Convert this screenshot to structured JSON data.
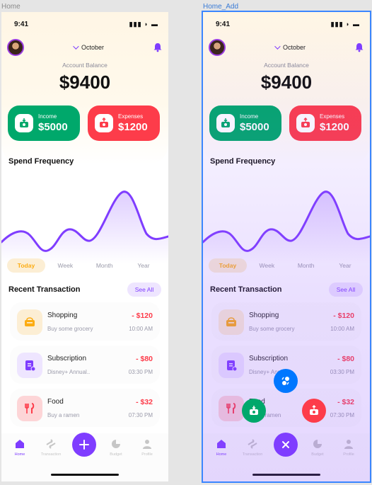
{
  "frames": {
    "left_label": "Home",
    "right_label": "Home_Add"
  },
  "status": {
    "time": "9:41"
  },
  "header": {
    "month": "October"
  },
  "balance": {
    "label": "Account Balance",
    "value": "$9400"
  },
  "cards": {
    "income": {
      "label": "Income",
      "amount": "$5000"
    },
    "expense": {
      "label": "Expenses",
      "amount": "$1200"
    }
  },
  "spend_frequency": {
    "title": "Spend Frequency"
  },
  "periods": [
    "Today",
    "Week",
    "Month",
    "Year"
  ],
  "recent": {
    "title": "Recent Transaction",
    "see_all": "See All"
  },
  "transactions": [
    {
      "name": "Shopping",
      "desc": "Buy some grocery",
      "amount": "- $120",
      "time": "10:00 AM"
    },
    {
      "name": "Subscription",
      "desc": "Disney+ Annual..",
      "amount": "- $80",
      "time": "03:30 PM"
    },
    {
      "name": "Food",
      "desc": "Buy a ramen",
      "amount": "- $32",
      "time": "07:30 PM"
    }
  ],
  "nav": {
    "home": "Home",
    "transaction": "Transaction",
    "budget": "Budget",
    "profile": "Profile"
  },
  "colors": {
    "primary": "#7f3dff",
    "income": "#00a86b",
    "expense": "#fd3c4a",
    "transfer": "#0077ff",
    "accent": "#fcac12"
  },
  "icons": [
    "battery-icon",
    "wifi-icon",
    "signal-icon",
    "chevron-down-icon",
    "bell-icon",
    "income-icon",
    "expense-icon",
    "shopping-icon",
    "subscription-icon",
    "food-icon",
    "home-icon",
    "transaction-icon",
    "plus-icon",
    "budget-icon",
    "profile-icon",
    "close-icon",
    "transfer-icon"
  ]
}
